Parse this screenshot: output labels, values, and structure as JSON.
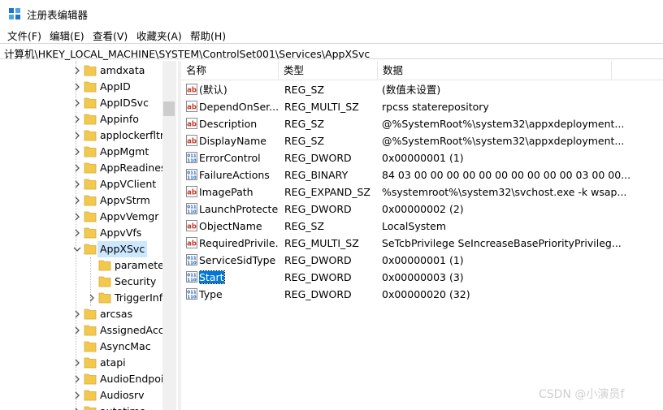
{
  "window": {
    "title": "注册表编辑器"
  },
  "menu": [
    "文件(F)",
    "编辑(E)",
    "查看(V)",
    "收藏夹(A)",
    "帮助(H)"
  ],
  "address": "计算机\\HKEY_LOCAL_MACHINE\\SYSTEM\\ControlSet001\\Services\\AppXSvc",
  "tree": [
    {
      "label": "amdxata",
      "expander": "collapsed"
    },
    {
      "label": "AppID",
      "expander": "collapsed"
    },
    {
      "label": "AppIDSvc",
      "expander": "collapsed"
    },
    {
      "label": "Appinfo",
      "expander": "collapsed"
    },
    {
      "label": "applockerfltr",
      "expander": "collapsed"
    },
    {
      "label": "AppMgmt",
      "expander": "collapsed"
    },
    {
      "label": "AppReadines",
      "expander": "collapsed"
    },
    {
      "label": "AppVClient",
      "expander": "collapsed"
    },
    {
      "label": "AppvStrm",
      "expander": "collapsed"
    },
    {
      "label": "AppvVemgr",
      "expander": "collapsed"
    },
    {
      "label": "AppvVfs",
      "expander": "collapsed"
    },
    {
      "label": "AppXSvc",
      "expander": "expanded",
      "selected": true
    },
    {
      "label": "parameter",
      "expander": "none",
      "child": true
    },
    {
      "label": "Security",
      "expander": "none",
      "child": true
    },
    {
      "label": "TriggerInf",
      "expander": "collapsed",
      "child": true
    },
    {
      "label": "arcsas",
      "expander": "collapsed"
    },
    {
      "label": "AssignedAcc",
      "expander": "collapsed"
    },
    {
      "label": "AsyncMac",
      "expander": "none"
    },
    {
      "label": "atapi",
      "expander": "collapsed"
    },
    {
      "label": "AudioEndpoi",
      "expander": "collapsed"
    },
    {
      "label": "Audiosrv",
      "expander": "collapsed"
    },
    {
      "label": "autotime",
      "expander": "collapsed"
    }
  ],
  "columns": {
    "name": "名称",
    "type": "类型",
    "data": "数据"
  },
  "values": [
    {
      "name": "(默认)",
      "type": "REG_SZ",
      "data": "(数值未设置)",
      "icon": "string"
    },
    {
      "name": "DependOnSer...",
      "type": "REG_MULTI_SZ",
      "data": "rpcss staterepository",
      "icon": "string"
    },
    {
      "name": "Description",
      "type": "REG_SZ",
      "data": "@%SystemRoot%\\system32\\appxdeployment...",
      "icon": "string"
    },
    {
      "name": "DisplayName",
      "type": "REG_SZ",
      "data": "@%SystemRoot%\\system32\\appxdeployment...",
      "icon": "string"
    },
    {
      "name": "ErrorControl",
      "type": "REG_DWORD",
      "data": "0x00000001 (1)",
      "icon": "binary"
    },
    {
      "name": "FailureActions",
      "type": "REG_BINARY",
      "data": "84 03 00 00 00 00 00 00 00 00 00 00 03 00 00...",
      "icon": "binary"
    },
    {
      "name": "ImagePath",
      "type": "REG_EXPAND_SZ",
      "data": "%systemroot%\\system32\\svchost.exe -k wsap...",
      "icon": "string"
    },
    {
      "name": "LaunchProtected",
      "type": "REG_DWORD",
      "data": "0x00000002 (2)",
      "icon": "binary"
    },
    {
      "name": "ObjectName",
      "type": "REG_SZ",
      "data": "LocalSystem",
      "icon": "string"
    },
    {
      "name": "RequiredPrivile...",
      "type": "REG_MULTI_SZ",
      "data": "SeTcbPrivilege SeIncreaseBasePriorityPrivileg...",
      "icon": "string"
    },
    {
      "name": "ServiceSidType",
      "type": "REG_DWORD",
      "data": "0x00000001 (1)",
      "icon": "binary"
    },
    {
      "name": "Start",
      "type": "REG_DWORD",
      "data": "0x00000003 (3)",
      "icon": "binary",
      "selected": true
    },
    {
      "name": "Type",
      "type": "REG_DWORD",
      "data": "0x00000020 (32)",
      "icon": "binary"
    }
  ],
  "watermark": "CSDN @小演员f",
  "colors": {
    "selection": "#0078d7",
    "tree_selection": "#cce8ff",
    "folder": "#f2c94c"
  }
}
